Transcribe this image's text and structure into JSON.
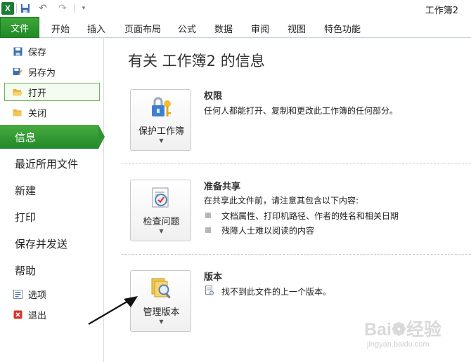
{
  "window": {
    "logo_letter": "X",
    "title": "工作簿2"
  },
  "ribbon": {
    "file_tab": "文件",
    "tabs": [
      "开始",
      "插入",
      "页面布局",
      "公式",
      "数据",
      "审阅",
      "视图",
      "特色功能"
    ]
  },
  "nav": {
    "commands": [
      {
        "label": "保存",
        "icon": "save-icon"
      },
      {
        "label": "另存为",
        "icon": "save-as-icon"
      },
      {
        "label": "打开",
        "icon": "open-folder-icon"
      },
      {
        "label": "关闭",
        "icon": "close-folder-icon"
      }
    ],
    "tabs": [
      "信息",
      "最近所用文件",
      "新建",
      "打印",
      "保存并发送",
      "帮助"
    ],
    "selected_tab": "信息",
    "footer": [
      {
        "label": "选项",
        "icon": "options-icon"
      },
      {
        "label": "退出",
        "icon": "exit-icon"
      }
    ]
  },
  "info": {
    "title": "有关 工作簿2 的信息",
    "permissions": {
      "button": "保护工作簿",
      "heading": "权限",
      "text": "任何人都能打开、复制和更改此工作簿的任何部分。"
    },
    "prepare": {
      "button": "检查问题",
      "heading": "准备共享",
      "text": "在共享此文件前，请注意其包含以下内容:",
      "bullets": [
        "文档属性、打印机路径、作者的姓名和相关日期",
        "残障人士难以阅读的内容"
      ]
    },
    "versions": {
      "button": "管理版本",
      "heading": "版本",
      "text": "找不到此文件的上一个版本。"
    }
  },
  "watermark": {
    "brand": "Bai",
    "suffix": "经验",
    "url": "jingyan.baidu.com"
  },
  "colors": {
    "accent_green": "#22882a",
    "file_tab_green": "#1f8a25"
  }
}
